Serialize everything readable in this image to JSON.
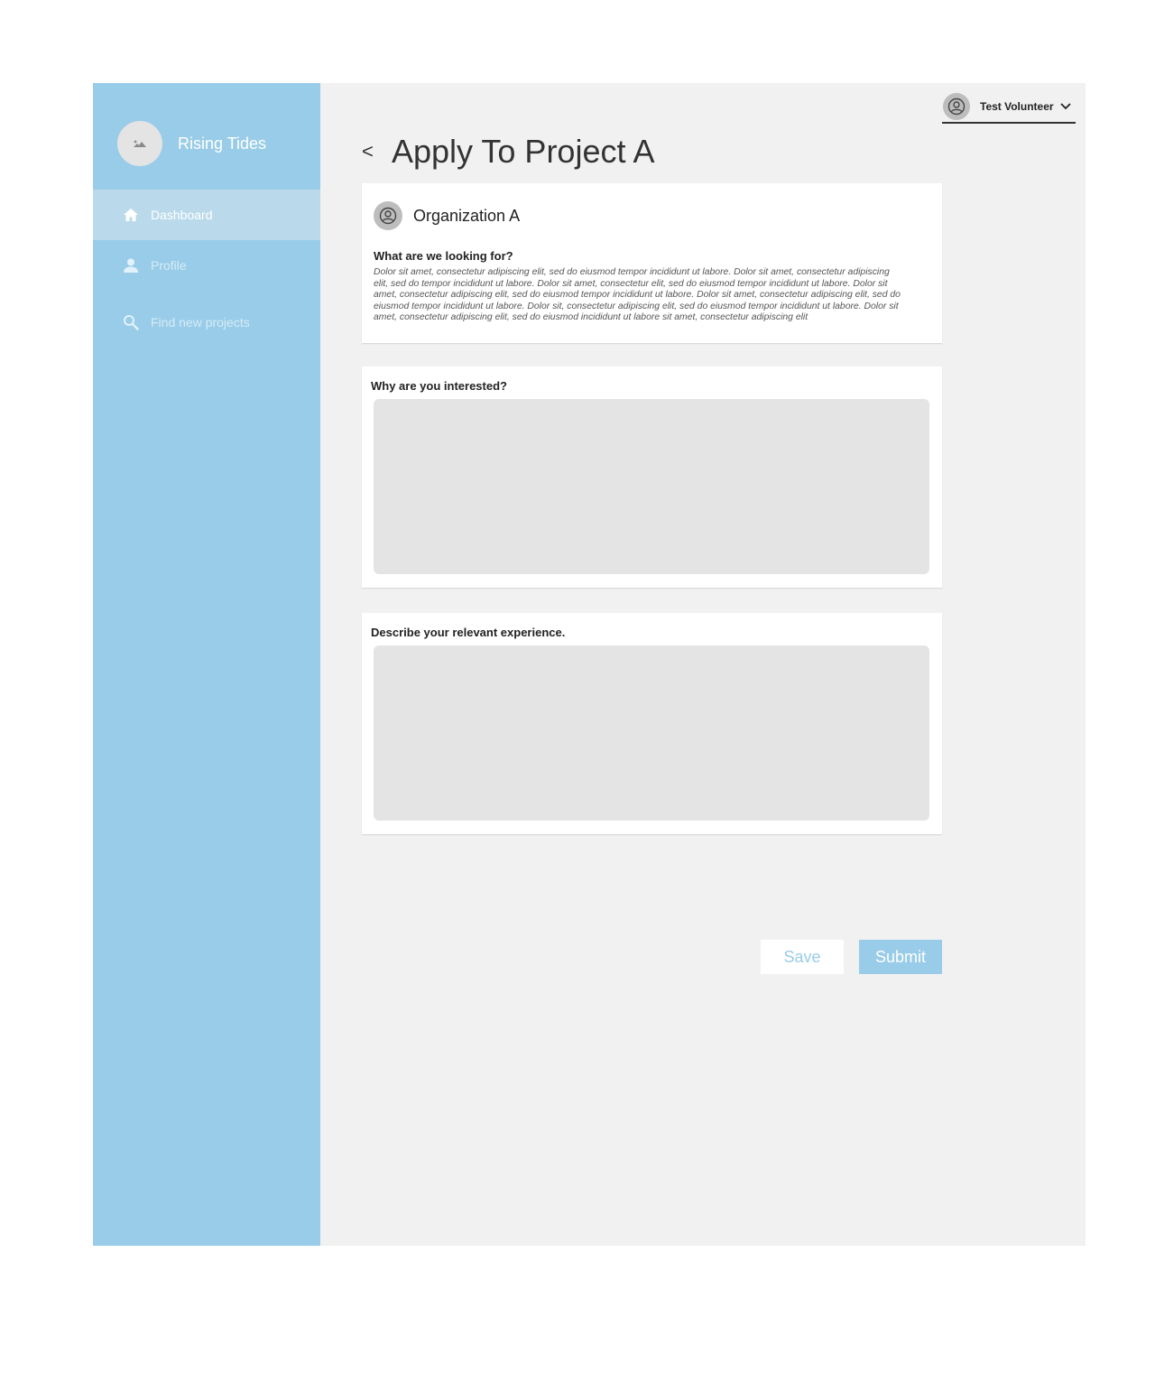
{
  "colors": {
    "sidebar": "#99cce8",
    "sidebar_active": "#badaec",
    "main_bg": "#f1f1f1",
    "input_bg": "#e4e4e4",
    "accent": "#99cce8"
  },
  "brand": {
    "name": "Rising Tides",
    "logo_icon": "image-icon"
  },
  "sidebar": {
    "items": [
      {
        "label": "Dashboard",
        "icon": "home-icon",
        "active": true
      },
      {
        "label": "Profile",
        "icon": "person-icon",
        "active": false
      },
      {
        "label": "Find new projects",
        "icon": "search-icon",
        "active": false
      }
    ]
  },
  "header": {
    "user_name": "Test Volunteer",
    "back_label": "<",
    "title": "Apply To Project A"
  },
  "org_card": {
    "name": "Organization A",
    "question": "What are we looking for?",
    "description": "Dolor sit amet, consectetur adipiscing elit, sed do eiusmod tempor incididunt ut labore. Dolor sit amet, consectetur adipiscing elit, sed do tempor incididunt ut labore. Dolor sit amet, consectetur elit, sed do eiusmod tempor incididunt ut labore. Dolor sit amet, consectetur adipiscing elit, sed do eiusmod tempor incididunt ut labore. Dolor sit amet, consectetur adipiscing elit, sed do eiusmod tempor incididunt ut labore. Dolor sit, consectetur adipiscing elit, sed do eiusmod tempor incididunt ut labore. Dolor sit amet, consectetur adipiscing elit, sed do eiusmod incididunt ut labore sit amet, consectetur adipiscing elit"
  },
  "questions": [
    {
      "label": "Why are you interested?",
      "value": ""
    },
    {
      "label": "Describe your relevant experience.",
      "value": ""
    }
  ],
  "actions": {
    "save_label": "Save",
    "submit_label": "Submit"
  }
}
